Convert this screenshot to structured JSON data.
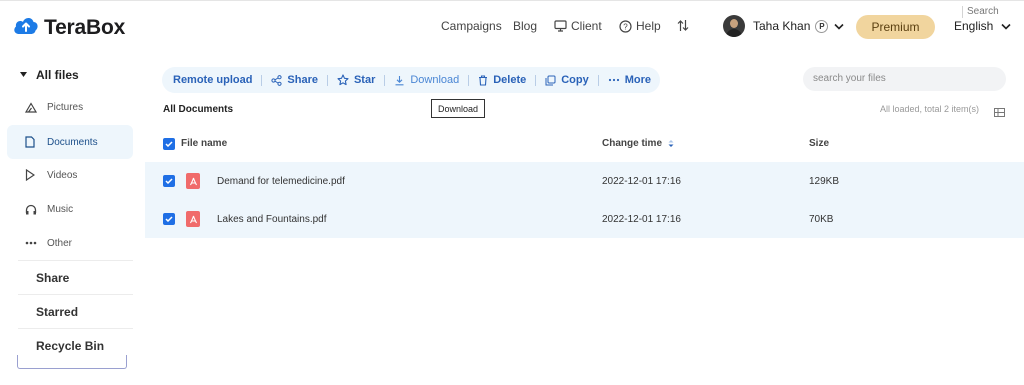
{
  "app": {
    "name": "TeraBox"
  },
  "header": {
    "nav": {
      "campaigns": "Campaigns",
      "blog": "Blog",
      "client": "Client",
      "help": "Help"
    },
    "user": {
      "name": "Taha Khan",
      "badge": "P"
    },
    "premium": "Premium",
    "language": "English"
  },
  "sidebar": {
    "all_files": "All files",
    "items": [
      {
        "label": "Pictures",
        "icon": "triangle-icon"
      },
      {
        "label": "Documents",
        "icon": "document-icon",
        "active": true
      },
      {
        "label": "Videos",
        "icon": "play-icon"
      },
      {
        "label": "Music",
        "icon": "headphones-icon"
      },
      {
        "label": "Other",
        "icon": "ellipsis-icon"
      }
    ],
    "share": "Share",
    "starred": "Starred",
    "recycle_bin": "Recycle Bin"
  },
  "toolbar": {
    "remote_upload": "Remote upload",
    "share": "Share",
    "star": "Star",
    "download": "Download",
    "delete": "Delete",
    "copy": "Copy",
    "more": "More"
  },
  "tooltip": "Download",
  "search": {
    "placeholder": "search your files",
    "button": "Search"
  },
  "content": {
    "breadcrumb": "All Documents",
    "status": "All loaded, total 2 item(s)"
  },
  "table": {
    "columns": {
      "name": "File name",
      "time": "Change time",
      "size": "Size"
    },
    "rows": [
      {
        "name": "Demand for telemedicine.pdf",
        "time": "2022-12-01 17:16",
        "size": "129KB"
      },
      {
        "name": "Lakes and Fountains.pdf",
        "time": "2022-12-01 17:16",
        "size": "70KB"
      }
    ]
  },
  "colors": {
    "accent": "#1f6fe5",
    "selected_row": "#eef6fc",
    "premium": "#f1d59e",
    "pdf": "#f06b6b"
  }
}
